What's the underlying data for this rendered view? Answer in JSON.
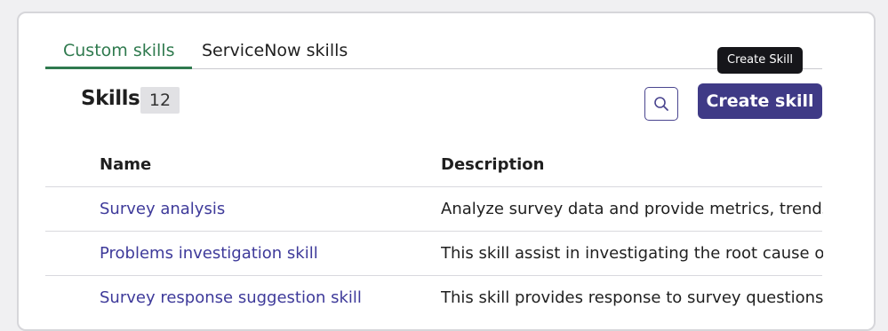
{
  "tabs": [
    {
      "label": "Custom skills",
      "active": true
    },
    {
      "label": "ServiceNow skills",
      "active": false
    }
  ],
  "header": {
    "title": "Skills",
    "count": "12",
    "search_icon": "search-icon",
    "create_button": "Create skill",
    "tooltip": "Create Skill"
  },
  "table": {
    "columns": [
      "Name",
      "Description"
    ],
    "rows": [
      {
        "name": "Survey analysis",
        "description": "Analyze survey data and provide metrics, trends a"
      },
      {
        "name": "Problems investigation skill",
        "description": "This skill assist in investigating the root cause of I"
      },
      {
        "name": "Survey response suggestion skill",
        "description": "This skill provides response to survey questions u"
      }
    ]
  },
  "colors": {
    "active_tab": "#2f7a4e",
    "primary_button": "#3f3a86",
    "link": "#3e3a9a"
  }
}
